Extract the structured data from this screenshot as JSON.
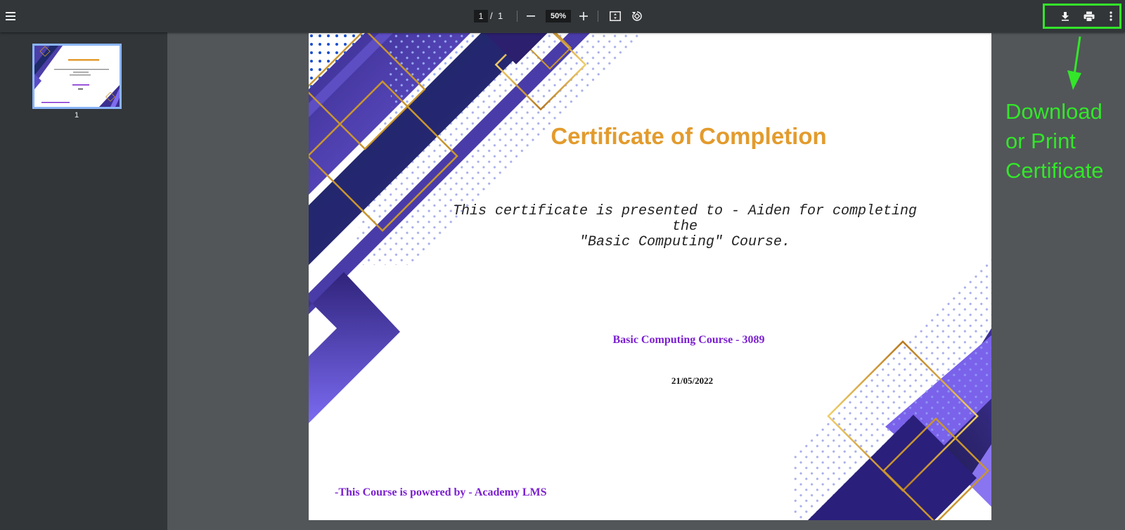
{
  "toolbar": {
    "page_current": "1",
    "page_separator": "/",
    "page_total": "1",
    "zoom": "50%",
    "icons": [
      "menu-icon",
      "zoom-out-icon",
      "zoom-in-icon",
      "fit-page-icon",
      "rotate-icon",
      "download-icon",
      "print-icon",
      "more-vert-icon"
    ]
  },
  "sidebar": {
    "thumbnails": [
      {
        "page_number": "1"
      }
    ]
  },
  "certificate": {
    "title": "Certificate of Completion",
    "body_line1": "This certificate is presented to - Aiden for completing",
    "body_line2": "the",
    "body_line3": "\"Basic Computing\" Course.",
    "course_code": "Basic Computing Course - 3089",
    "date": "21/05/2022",
    "footer": "-This Course is powered by - Academy LMS"
  },
  "annotation": {
    "line1": "Download",
    "line2": "or Print",
    "line3": "Certificate",
    "color": "#33e62a"
  },
  "colors": {
    "toolbar_bg": "#323639",
    "viewer_bg": "#525659",
    "title_gold": "#e39b2d",
    "course_purple": "#7b1fd0",
    "thumb_highlight": "#8ab4f8"
  }
}
